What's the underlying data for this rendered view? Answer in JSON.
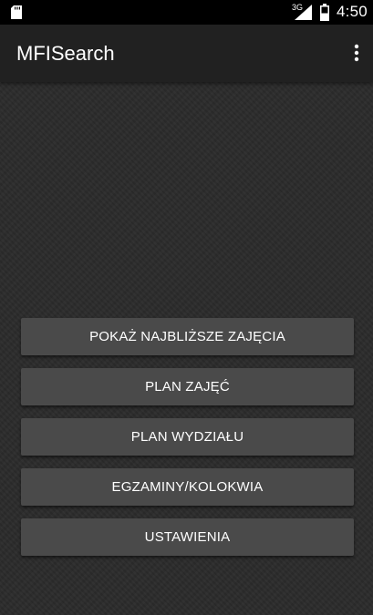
{
  "status_bar": {
    "network_type": "3G",
    "time": "4:50",
    "icons": [
      "sd-card-icon",
      "signal-icon",
      "battery-icon"
    ]
  },
  "app_bar": {
    "title": "MFISearch",
    "menu_icon": "overflow-menu-icon"
  },
  "menu": {
    "buttons": [
      {
        "label": "POKAŻ NAJBLIŻSZE ZAJĘCIA"
      },
      {
        "label": "PLAN ZAJĘĆ"
      },
      {
        "label": "PLAN WYDZIAŁU"
      },
      {
        "label": "EGZAMINY/KOLOKWIA"
      },
      {
        "label": "USTAWIENIA"
      }
    ]
  },
  "colors": {
    "status_bar": "#000000",
    "app_bar": "#212121",
    "background": "#2b2b2b",
    "button": "#4a4a4a",
    "text": "#ffffff"
  }
}
